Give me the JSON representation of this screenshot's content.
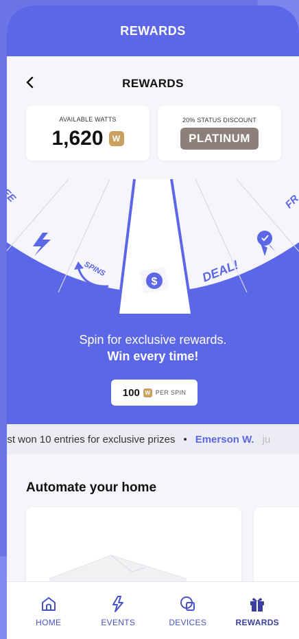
{
  "header": {
    "title": "REWARDS"
  },
  "subheader": {
    "title": "REWARDS",
    "back_icon": "chevron-left-icon"
  },
  "stats": {
    "watts": {
      "label": "AVAILABLE WATTS",
      "value": "1,620",
      "badge": "W"
    },
    "status": {
      "label": "20% STATUS DISCOUNT",
      "tier": "PLATINUM"
    }
  },
  "wheel": {
    "segments": [
      "EE",
      "bolt-icon",
      "SPINS",
      "dollar-icon",
      "DEAL!",
      "ribbon-icon",
      "FR"
    ]
  },
  "spin": {
    "line1": "Spin for exclusive rewards.",
    "line2": "Win every time!",
    "cost_value": "100",
    "cost_badge": "W",
    "cost_unit": "PER SPIN"
  },
  "ticker": {
    "message": "ust won 10 entries for exclusive prizes",
    "separator": "•",
    "next_name": "Emerson W.",
    "next_tail": "ju"
  },
  "section": {
    "title": "Automate your home"
  },
  "nav": [
    {
      "label": "HOME",
      "icon": "home-icon"
    },
    {
      "label": "EVENTS",
      "icon": "events-icon"
    },
    {
      "label": "DEVICES",
      "icon": "devices-icon"
    },
    {
      "label": "REWARDS",
      "icon": "gift-icon"
    }
  ],
  "colors": {
    "primary": "#5b67e6",
    "gold": "#c9a060",
    "tier": "#8d7f7a"
  }
}
